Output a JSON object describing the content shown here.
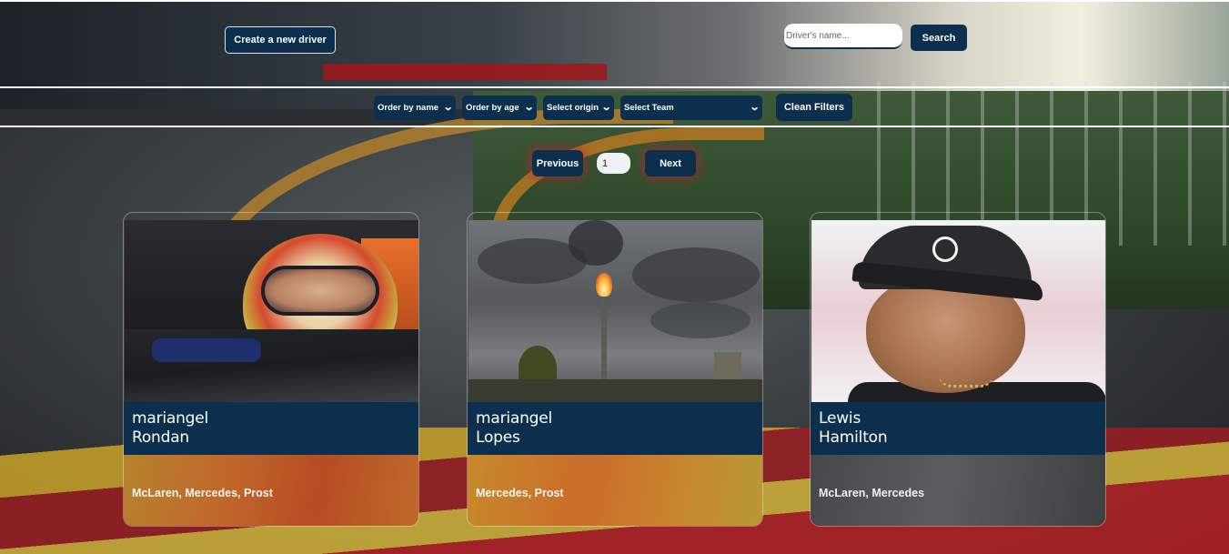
{
  "header": {
    "create_label": "Create a new driver",
    "search_placeholder": "Driver's name...",
    "search_label": "Search"
  },
  "filters": {
    "order_name": "Order by name",
    "order_age": "Order by age",
    "origin": "Select origin",
    "team": "Select Team",
    "clean_label": "Clean Filters"
  },
  "pagination": {
    "prev_label": "Previous",
    "page": "1",
    "next_label": "Next"
  },
  "cards": [
    {
      "first_name": "mariangel",
      "last_name": "Rondan",
      "teams": "McLaren, Mercedes, Prost"
    },
    {
      "first_name": "mariangel",
      "last_name": "Lopes",
      "teams": "Mercedes, Prost"
    },
    {
      "first_name": "Lewis",
      "last_name": "Hamilton",
      "teams": "McLaren, Mercedes"
    }
  ],
  "colors": {
    "primary": "#0b2f4d",
    "divider": "#ffffff"
  },
  "icons": {
    "select_chevron": "chevron-down-icon"
  }
}
